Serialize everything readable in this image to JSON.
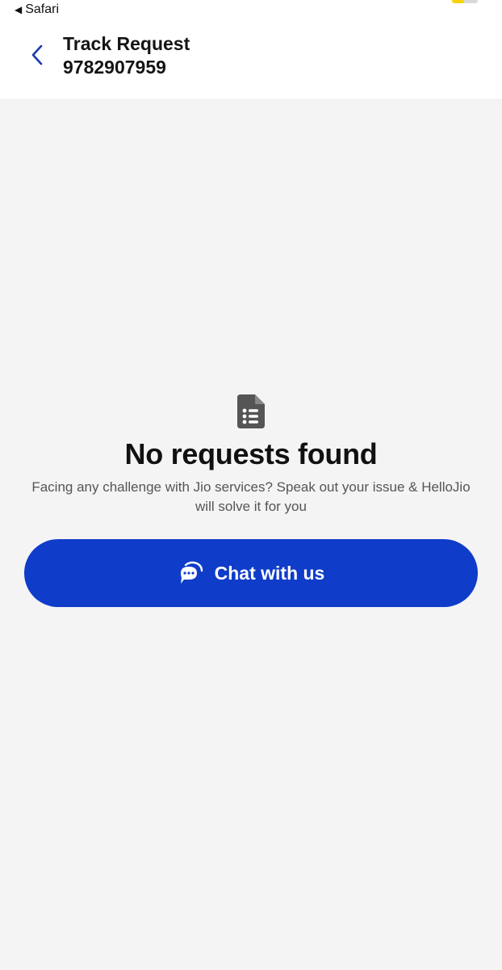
{
  "status_bar": {
    "back_to_app_label": "Safari",
    "back_arrow_icon": "triangle-left-icon",
    "battery_accent": "#f5d20a"
  },
  "header": {
    "back_icon": "chevron-left-icon",
    "title": "Track Request",
    "subtitle": "9782907959"
  },
  "empty_state": {
    "icon": "document-list-icon",
    "title": "No requests found",
    "description": "Facing any challenge with Jio services? Speak out your issue & HelloJio will solve it for you"
  },
  "chat_button": {
    "icon": "chat-bubble-icon",
    "label": "Chat with us",
    "color": "#0f3cc9"
  },
  "colors": {
    "background": "#f4f4f5",
    "accent": "#0f3cc9",
    "chevron": "#1a3aa8"
  }
}
